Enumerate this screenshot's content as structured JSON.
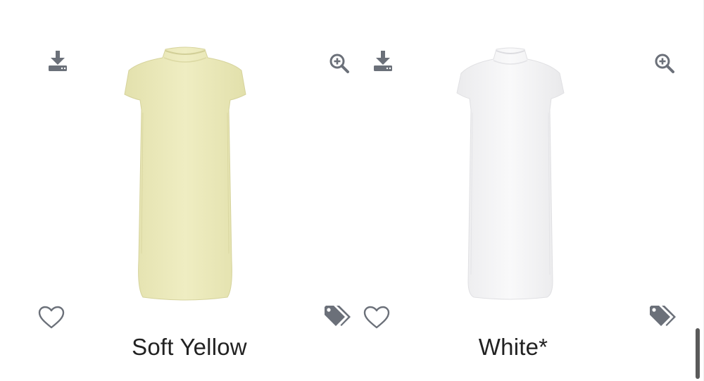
{
  "products": [
    {
      "color_name": "Soft Yellow",
      "swatch": "#eceab9",
      "icons": [
        "download-icon",
        "zoom-in-icon",
        "heart-icon",
        "tags-icon"
      ]
    },
    {
      "color_name": "White*",
      "swatch": "#ffffff",
      "icons": [
        "download-icon",
        "zoom-in-icon",
        "heart-icon",
        "tags-icon"
      ]
    }
  ],
  "colors": {
    "icon_gray": "#6b7079",
    "text": "#222222"
  }
}
